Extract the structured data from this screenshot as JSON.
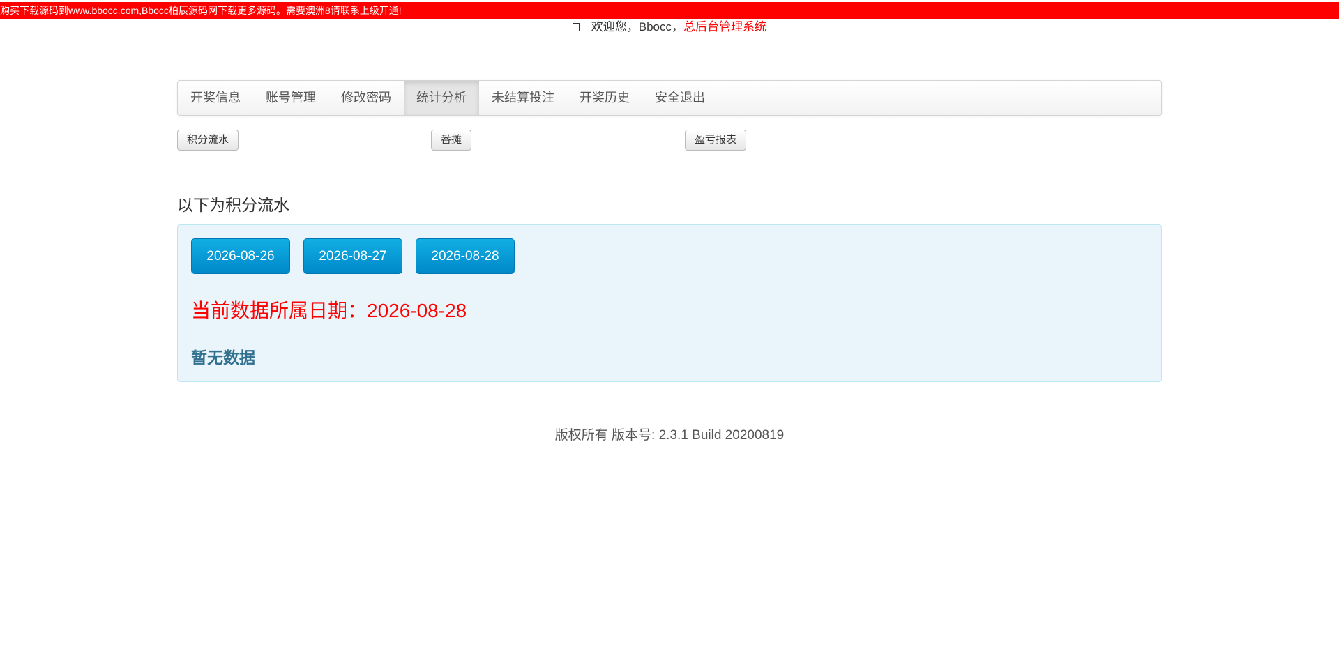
{
  "banner": {
    "text": "购买下载源码到www.bbocc.com,Bbocc柏辰源码网下载更多源码。需要澳洲8请联系上级开通!"
  },
  "header": {
    "user_icon": "user-icon",
    "welcome_text": "欢迎您，Bbocc，",
    "system_link": "总后台管理系统"
  },
  "nav": {
    "items": [
      {
        "label": "开奖信息"
      },
      {
        "label": "账号管理"
      },
      {
        "label": "修改密码"
      },
      {
        "label": "统计分析",
        "active": true
      },
      {
        "label": "未结算投注"
      },
      {
        "label": "开奖历史"
      },
      {
        "label": "安全退出"
      }
    ]
  },
  "subnav": {
    "points_flow": "积分流水",
    "fantan": "番摊",
    "profit_report": "盈亏报表"
  },
  "section": {
    "title": "以下为积分流水"
  },
  "panel": {
    "dates": [
      "2026-08-26",
      "2026-08-27",
      "2026-08-28"
    ],
    "current_date_label": "当前数据所属日期：2026-08-28",
    "no_data": "暂无数据"
  },
  "footer": {
    "text": "版权所有 版本号: 2.3.1 Build 20200819"
  },
  "colors": {
    "banner_bg": "#ff0000",
    "date_button": "#0089c9",
    "panel_bg": "#eaf5fb",
    "no_data_text": "#31708f"
  }
}
